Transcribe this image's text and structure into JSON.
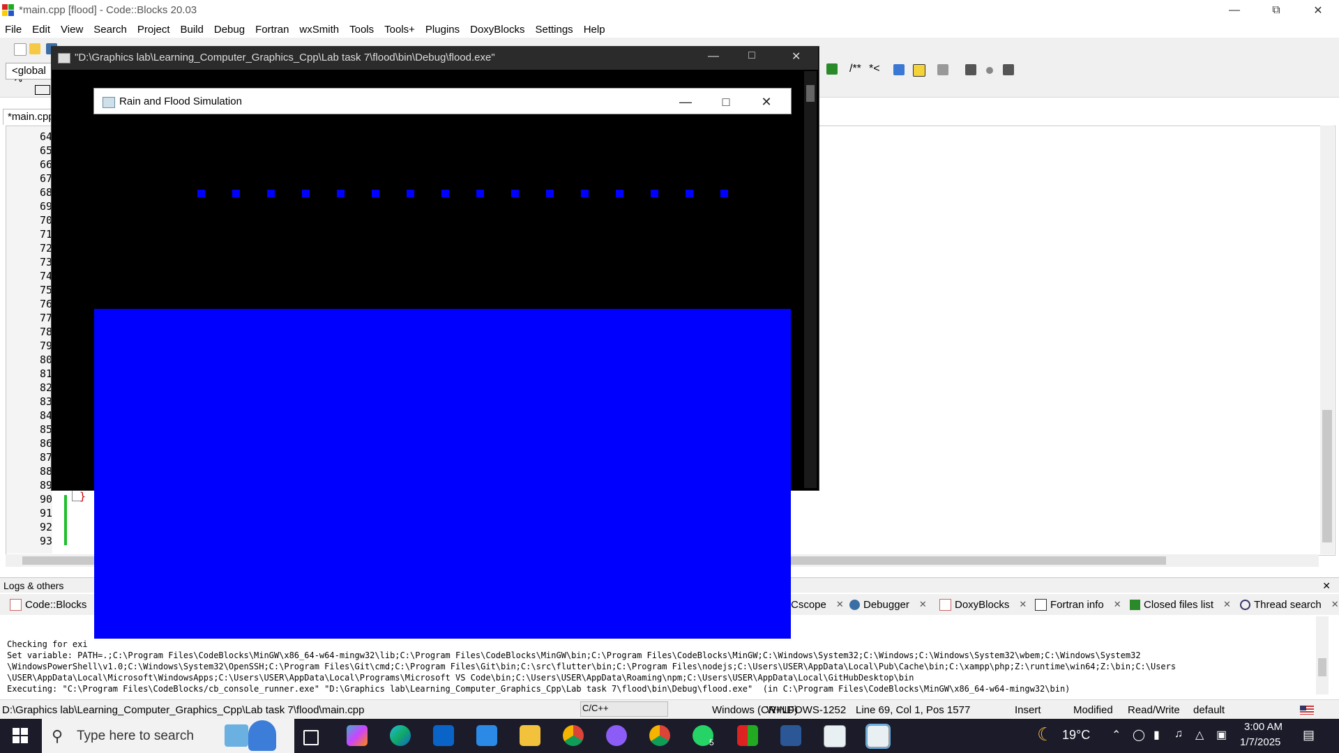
{
  "ide": {
    "title": "*main.cpp [flood] - Code::Blocks 20.03",
    "menu": [
      "File",
      "Edit",
      "View",
      "Search",
      "Project",
      "Build",
      "Debug",
      "Fortran",
      "wxSmith",
      "Tools",
      "Tools+",
      "Plugins",
      "DoxyBlocks",
      "Settings",
      "Help"
    ],
    "scope_box": "<global",
    "toolbar_text": [
      "/**",
      "*<"
    ],
    "editor_tab": "*main.cpp",
    "line_numbers": [
      "64",
      "65",
      "66",
      "67",
      "68",
      "69",
      "70",
      "71",
      "72",
      "73",
      "74",
      "75",
      "76",
      "77",
      "78",
      "79",
      "80",
      "81",
      "82",
      "83",
      "84",
      "85",
      "86",
      "87",
      "88",
      "89",
      "90",
      "91",
      "92",
      "93"
    ],
    "code_line_90": "}"
  },
  "logs": {
    "header": "Logs & others",
    "tabs": [
      "Code::Blocks",
      "Cscope",
      "Debugger",
      "DoxyBlocks",
      "Fortran info",
      "Closed files list",
      "Thread search"
    ],
    "lines": [
      "Checking for exi",
      "Set variable: PATH=.;C:\\Program Files\\CodeBlocks\\MinGW\\x86_64-w64-mingw32\\lib;C:\\Program Files\\CodeBlocks\\MinGW\\bin;C:\\Program Files\\CodeBlocks\\MinGW;C:\\Windows\\System32;C:\\Windows;C:\\Windows\\System32\\wbem;C:\\Windows\\System32",
      "\\WindowsPowerShell\\v1.0;C:\\Windows\\System32\\OpenSSH;C:\\Program Files\\Git\\cmd;C:\\Program Files\\Git\\bin;C:\\src\\flutter\\bin;C:\\Program Files\\nodejs;C:\\Users\\USER\\AppData\\Local\\Pub\\Cache\\bin;C:\\xampp\\php;Z:\\runtime\\win64;Z:\\bin;C:\\Users",
      "\\USER\\AppData\\Local\\Microsoft\\WindowsApps;C:\\Users\\USER\\AppData\\Local\\Programs\\Microsoft VS Code\\bin;C:\\Users\\USER\\AppData\\Roaming\\npm;C:\\Users\\USER\\AppData\\Local\\GitHubDesktop\\bin",
      "Executing: \"C:\\Program Files\\CodeBlocks/cb_console_runner.exe\" \"D:\\Graphics lab\\Learning_Computer_Graphics_Cpp\\Lab task 7\\flood\\bin\\Debug\\flood.exe\"  (in C:\\Program Files\\CodeBlocks\\MinGW\\x86_64-w64-mingw32\\bin)"
    ]
  },
  "status": {
    "path": "D:\\Graphics lab\\Learning_Computer_Graphics_Cpp\\Lab task 7\\flood\\main.cpp",
    "lang": "C/C++",
    "eol": "Windows (CR+LF)",
    "encoding": "WINDOWS-1252",
    "position": "Line 69, Col 1, Pos 1577",
    "mode": "Insert",
    "modified": "Modified",
    "rw": "Read/Write",
    "profile": "default"
  },
  "console": {
    "title": "\"D:\\Graphics lab\\Learning_Computer_Graphics_Cpp\\Lab task 7\\flood\\bin\\Debug\\flood.exe\""
  },
  "sim": {
    "title": "Rain and Flood Simulation",
    "drop_count": 16,
    "water_color": "#0000ff",
    "background_color": "#000000"
  },
  "taskbar": {
    "search_placeholder": "Type here to search",
    "weather": "19°C",
    "time": "3:00 AM",
    "date": "1/7/2025",
    "whatsapp_badge": "5"
  }
}
